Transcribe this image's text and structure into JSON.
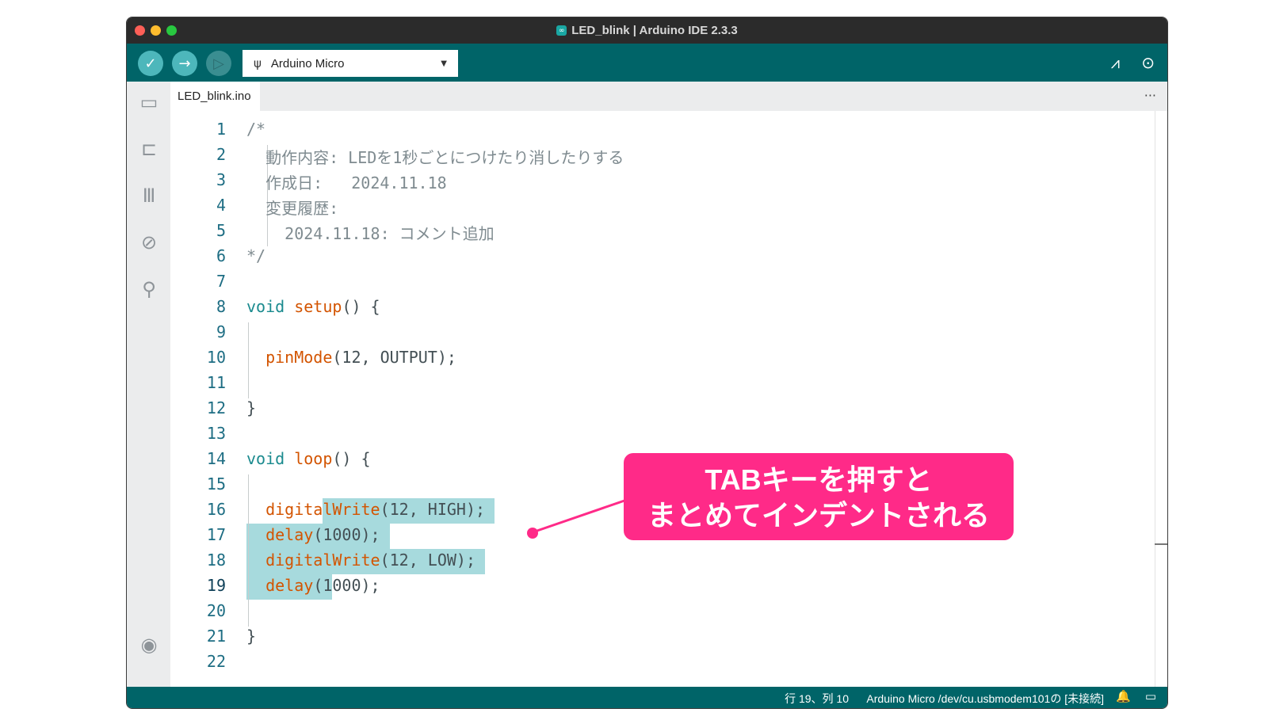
{
  "window": {
    "title": "LED_blink | Arduino IDE 2.3.3",
    "app_icon": "∞"
  },
  "toolbar": {
    "verify_icon": "✓",
    "upload_icon": "→",
    "debug_icon": "▷",
    "board_usb_icon": "ψ",
    "board_name": "Arduino Micro",
    "board_caret": "▼",
    "serial_plotter_icon": "⩘",
    "serial_monitor_icon": "⊙"
  },
  "sidebar": {
    "sketchbook_icon": "▭",
    "boards_icon": "⊏",
    "library_icon": "Ⅲ",
    "debug_icon": "⊘",
    "search_icon": "⚲",
    "account_icon": "◉"
  },
  "tabs": {
    "active": "LED_blink.ino",
    "more": "···"
  },
  "editor": {
    "line_numbers": [
      "1",
      "2",
      "3",
      "4",
      "5",
      "6",
      "7",
      "8",
      "9",
      "10",
      "11",
      "12",
      "13",
      "14",
      "15",
      "16",
      "17",
      "18",
      "19",
      "20",
      "21",
      "22"
    ],
    "lines": [
      [
        {
          "t": "/*",
          "c": "cmt"
        }
      ],
      [
        {
          "t": "  動作内容: LEDを1秒ごとにつけたり消したりする",
          "c": "cmt"
        }
      ],
      [
        {
          "t": "  作成日:   2024.11.18",
          "c": "cmt"
        }
      ],
      [
        {
          "t": "  変更履歴:",
          "c": "cmt"
        }
      ],
      [
        {
          "t": "    2024.11.18: コメント追加",
          "c": "cmt"
        }
      ],
      [
        {
          "t": "*/",
          "c": "cmt"
        }
      ],
      [],
      [
        {
          "t": "void",
          "c": "kw"
        },
        {
          "t": " ",
          "c": ""
        },
        {
          "t": "setup",
          "c": "fn"
        },
        {
          "t": "() {",
          "c": ""
        }
      ],
      [],
      [
        {
          "t": "  ",
          "c": ""
        },
        {
          "t": "pinMode",
          "c": "fn"
        },
        {
          "t": "(12, OUTPUT);",
          "c": ""
        }
      ],
      [],
      [
        {
          "t": "}",
          "c": ""
        }
      ],
      [],
      [
        {
          "t": "void",
          "c": "kw"
        },
        {
          "t": " ",
          "c": ""
        },
        {
          "t": "loop",
          "c": "fn"
        },
        {
          "t": "() {",
          "c": ""
        }
      ],
      [],
      [
        {
          "t": "  ",
          "c": ""
        },
        {
          "t": "digitalWrite",
          "c": "fn"
        },
        {
          "t": "(12, HIGH);",
          "c": ""
        }
      ],
      [
        {
          "t": "  ",
          "c": ""
        },
        {
          "t": "delay",
          "c": "fn"
        },
        {
          "t": "(1000);",
          "c": ""
        }
      ],
      [
        {
          "t": "  ",
          "c": ""
        },
        {
          "t": "digitalWrite",
          "c": "fn"
        },
        {
          "t": "(12, LOW);",
          "c": ""
        }
      ],
      [
        {
          "t": "  ",
          "c": ""
        },
        {
          "t": "delay",
          "c": "fn"
        },
        {
          "t": "(1000);",
          "c": ""
        }
      ],
      [],
      [
        {
          "t": "}",
          "c": ""
        }
      ],
      []
    ],
    "active_line": 19
  },
  "statusbar": {
    "cursor": "行 19、列 10",
    "board_port": "Arduino Micro /dev/cu.usbmodem101の [未接続]",
    "bell_icon": "🔔",
    "panel_icon": "▭"
  },
  "annotation": {
    "line1": "TABキーを押すと",
    "line2": "まとめてインデントされる",
    "color": "#ff2a88"
  }
}
